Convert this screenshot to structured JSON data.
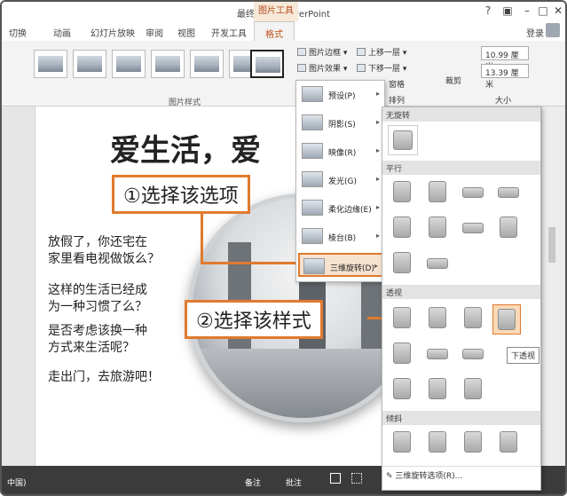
{
  "window": {
    "title": "最终文件 - PowerPoint",
    "context_tool": "图片工具",
    "help": "?",
    "restore": "▣",
    "minimize": "–",
    "maximize": "□",
    "close": "✕"
  },
  "tabs": {
    "items": [
      "切换",
      "动画",
      "幻灯片放映",
      "审阅",
      "视图",
      "开发工具"
    ],
    "active": "格式",
    "login": "登录"
  },
  "ribbon": {
    "picture_styles_label": "图片样式",
    "picture_border": "图片边框",
    "picture_effects": "图片效果",
    "bring_forward": "上移一层",
    "send_backward": "下移一层",
    "selection_pane": "窗格",
    "arrange_label": "排列",
    "crop": "裁剪",
    "height": "10.99 厘米",
    "width": "13.39 厘米",
    "size_label": "大小"
  },
  "slide": {
    "title": "爱生活，爱",
    "paragraphs": [
      [
        "放假了，你还宅在",
        "家里看电视做饭么？"
      ],
      [
        "这样的生活已经成",
        "为一种习惯了么？"
      ],
      [
        "是否考虑该换一种",
        "方式来生活呢？"
      ],
      [
        "走出门，去旅游吧！"
      ]
    ]
  },
  "callouts": {
    "step1": "①选择该选项",
    "step2": "②选择该样式"
  },
  "effects_menu": {
    "items": [
      {
        "label": "预设(P)"
      },
      {
        "label": "阴影(S)"
      },
      {
        "label": "映像(R)"
      },
      {
        "label": "发光(G)"
      },
      {
        "label": "柔化边缘(E)"
      },
      {
        "label": "棱台(B)"
      },
      {
        "label": "三维旋转(D)"
      }
    ],
    "arrow": "▸"
  },
  "rotation_gallery": {
    "sections": [
      "无旋转",
      "平行",
      "透视",
      "倾斜"
    ],
    "tooltip": "下透视",
    "footer": "三维旋转选项(R)..."
  },
  "status_bar": {
    "lang": "中国)",
    "notes": "备注",
    "comments": "批注"
  },
  "colors": {
    "accent_orange": "#e07a2e",
    "context_tab_text": "#c14d15",
    "status_bar": "#3b3b3b"
  }
}
